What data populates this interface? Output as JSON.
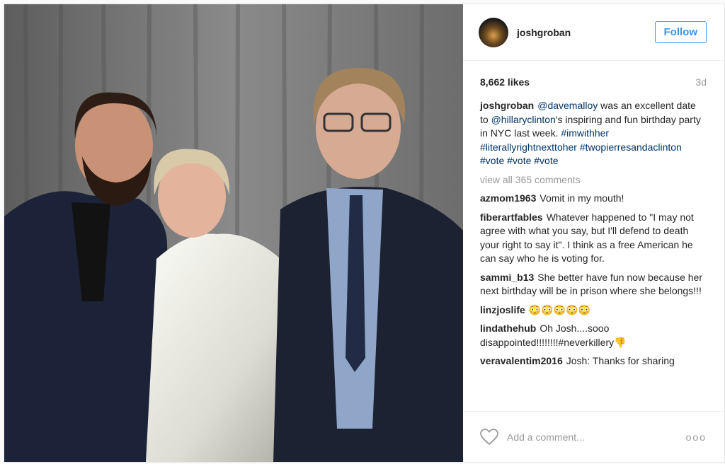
{
  "header": {
    "username": "joshgroban",
    "follow_label": "Follow"
  },
  "stats": {
    "likes": "8,662 likes",
    "age": "3d"
  },
  "caption": {
    "user": "joshgroban",
    "parts": [
      {
        "text": "@davemalloy",
        "link": true
      },
      {
        "text": " was an excellent date to ",
        "link": false
      },
      {
        "text": "@hillaryclinton",
        "link": true
      },
      {
        "text": "'s inspiring and fun birthday party in NYC last week. ",
        "link": false
      },
      {
        "text": "#imwithher #literallyrightnexttoher #twopierresandaclinton #vote #vote #vote",
        "link": true
      }
    ]
  },
  "view_all": "view all 365 comments",
  "comments": [
    {
      "user": "azmom1963",
      "text": "Vomit in my mouth!"
    },
    {
      "user": "fiberartfables",
      "text": "Whatever happened to \"I may not agree with what you say, but I'll defend to death your right to say it\". I think as a free American he can say who he is voting for."
    },
    {
      "user": "sammi_b13",
      "text": "She better have fun now because her next birthday will be in prison where she belongs!!!"
    },
    {
      "user": "linzjoslife",
      "text": "😳😳😳😳😳"
    },
    {
      "user": "lindathehub",
      "text": "Oh Josh....sooo disappointed!!!!!!!!#neverkillery👎"
    },
    {
      "user": "veravalentim2016",
      "text": "Josh: Thanks for sharing"
    }
  ],
  "footer": {
    "add_comment_placeholder": "Add a comment...",
    "more": "ooo"
  },
  "icons": {
    "heart": "heart-icon",
    "more": "more-options-icon"
  },
  "colors": {
    "accent": "#3897f0",
    "link": "#003569",
    "muted": "#999999"
  }
}
